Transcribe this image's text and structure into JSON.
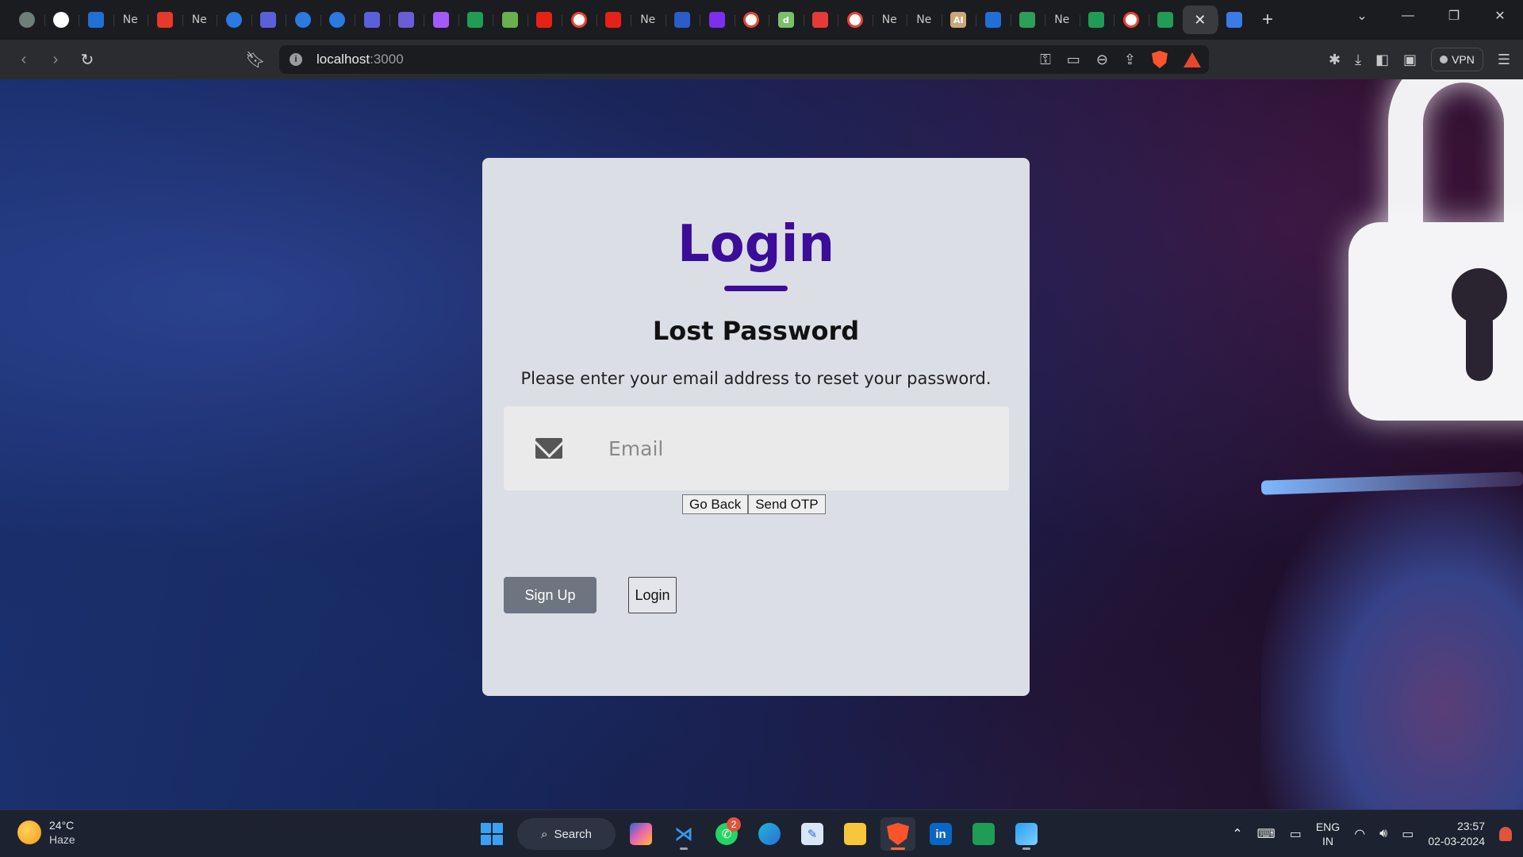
{
  "browser": {
    "tabs": [
      {
        "icon": "chatgpt-icon",
        "label": "",
        "color": "#6e7f77"
      },
      {
        "icon": "github-icon",
        "label": "",
        "color": "#ffffff"
      },
      {
        "icon": "dc-icon",
        "label": "",
        "color": "#1f6fd6"
      },
      {
        "icon": "ne-icon",
        "label": "Ne",
        "color": ""
      },
      {
        "icon": "adobe-icon",
        "label": "",
        "color": "#e53a2a"
      },
      {
        "icon": "ne-icon",
        "label": "Ne",
        "color": ""
      },
      {
        "icon": "c-icon",
        "label": "",
        "color": "#2a7ae2"
      },
      {
        "icon": "chat-icon",
        "label": "",
        "color": "#5b5fd9"
      },
      {
        "icon": "c-icon",
        "label": "",
        "color": "#2a7ae2"
      },
      {
        "icon": "c-icon",
        "label": "",
        "color": "#2a7ae2"
      },
      {
        "icon": "chat-icon",
        "label": "",
        "color": "#5b5fd9"
      },
      {
        "icon": "chat-icon",
        "label": "",
        "color": "#6b5cd8"
      },
      {
        "icon": "figma-icon",
        "label": "",
        "color": "#a259ff"
      },
      {
        "icon": "meet-icon",
        "label": "",
        "color": "#1f9d55"
      },
      {
        "icon": "leaf-icon",
        "label": "",
        "color": "#6ab04c"
      },
      {
        "icon": "youtube-icon",
        "label": "",
        "color": "#e62117"
      },
      {
        "icon": "google-icon",
        "label": "",
        "color": "#ffffff"
      },
      {
        "icon": "youtube-icon",
        "label": "",
        "color": "#e62117"
      },
      {
        "icon": "ne-icon",
        "label": "Ne",
        "color": ""
      },
      {
        "icon": "crown-icon",
        "label": "",
        "color": "#2b5cc8"
      },
      {
        "icon": "arrow-icon",
        "label": "",
        "color": "#7b2ff0"
      },
      {
        "icon": "google-icon",
        "label": "",
        "color": "#ffffff"
      },
      {
        "icon": "d-icon",
        "label": "d",
        "color": "#7bbf6a"
      },
      {
        "icon": "heart-icon",
        "label": "",
        "color": "#e53a3a"
      },
      {
        "icon": "google-icon",
        "label": "",
        "color": "#ffffff"
      },
      {
        "icon": "ne-icon",
        "label": "Ne",
        "color": ""
      },
      {
        "icon": "ne-icon",
        "label": "Ne",
        "color": ""
      },
      {
        "icon": "ai-icon",
        "label": "AI",
        "color": "#c9a77a"
      },
      {
        "icon": "outlook-icon",
        "label": "",
        "color": "#1f6fd6"
      },
      {
        "icon": "glasses-icon",
        "label": "",
        "color": "#2e9e5b"
      },
      {
        "icon": "ne-icon",
        "label": "Ne",
        "color": ""
      },
      {
        "icon": "meet-icon",
        "label": "",
        "color": "#1f9d55"
      },
      {
        "icon": "google-icon",
        "label": "",
        "color": "#ffffff"
      },
      {
        "icon": "meet-icon",
        "label": "",
        "color": "#1f9d55"
      }
    ],
    "active_tab_close": "✕",
    "docs_icon_color": "#3b7be8",
    "new_tab_label": "+",
    "url_host": "localhost",
    "url_port": ":3000",
    "vpn_label": "VPN"
  },
  "page": {
    "login_title": "Login",
    "subtitle": "Lost Password",
    "description": "Please enter your email address to reset your password.",
    "email_placeholder": "Email",
    "go_back_label": "Go Back",
    "send_otp_label": "Send OTP",
    "signup_label": "Sign Up",
    "login_label": "Login",
    "accent_color": "#3c0d99"
  },
  "taskbar": {
    "weather_temp": "24°C",
    "weather_desc": "Haze",
    "search_label": "Search",
    "whatsapp_badge": "2",
    "lang_line1": "ENG",
    "lang_line2": "IN",
    "time": "23:57",
    "date": "02-03-2024"
  }
}
